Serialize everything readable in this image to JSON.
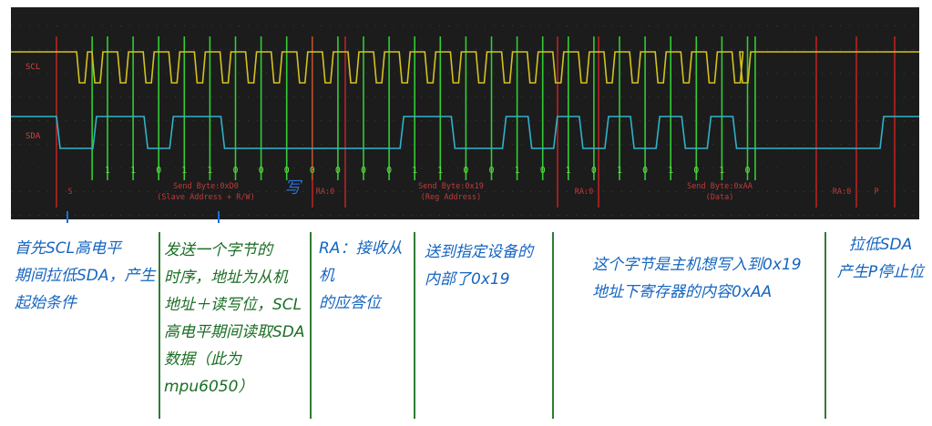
{
  "scope": {
    "channel_scl": "SCL",
    "channel_sda": "SDA",
    "bits": [
      "1",
      "1",
      "0",
      "1",
      "1",
      "0",
      "0",
      "0",
      "0",
      "0",
      "0",
      "0",
      "1",
      "1",
      "0",
      "0",
      "1",
      "0",
      "1",
      "0",
      "1",
      "0",
      "1",
      "0",
      "1",
      "0"
    ],
    "decode": [
      {
        "label": "S"
      },
      {
        "label": "Send Byte:0xD0",
        "sublabel": "(Slave Address + R/W)"
      },
      {
        "label": "RA:0"
      },
      {
        "label": "Send Byte:0x19",
        "sublabel": "(Reg Address)"
      },
      {
        "label": "RA:0"
      },
      {
        "label": "Send Byte:0xAA",
        "sublabel": "(Data)"
      },
      {
        "label": "RA:0"
      },
      {
        "label": "P"
      }
    ],
    "write_mark": "写",
    "colors": {
      "scl": "#d4c21f",
      "sda": "#2fb3c9",
      "clock_marker": "#33cc33",
      "boundary": "#dd2222",
      "decode_text": "#c23a3a",
      "bit_text": "#66dd44",
      "background": "#1c1c1c"
    }
  },
  "notes": {
    "start": "首先SCL高电平\n期间拉低SDA，产生\n起始条件",
    "byte1": "发送一个字节的\n时序，地址为从机\n地址＋读写位，SCL\n高电平期间读取SDA\n数据（此为mpu6050）",
    "ack": "RA：接收从机\n的应答位",
    "reg": "送到指定设备的\n内部了0x19",
    "data": "这个字节是主机想写入到0x19\n地址下寄存器的内容0xAA",
    "stop": "拉低SDA\n产生P停止位"
  }
}
